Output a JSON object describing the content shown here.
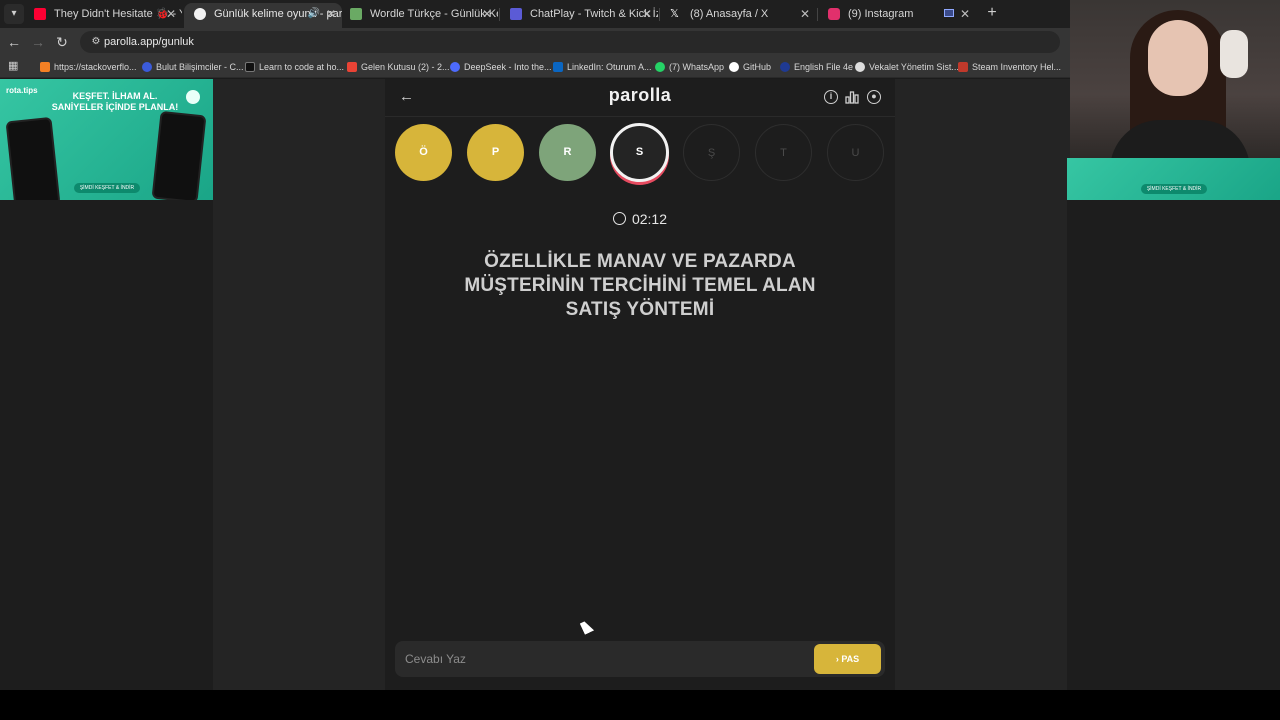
{
  "browser": {
    "tabs": [
      {
        "label": "They Didn't Hesitate 🐞 - YouTube",
        "favicon_color": "#ff0033",
        "icon": "youtube-icon"
      },
      {
        "label": "Günlük kelime oyunu - parolla",
        "favicon_color": "#f2f2f2",
        "icon": "parolla-icon",
        "active": true
      },
      {
        "label": "Wordle Türkçe - Günlük Kelime",
        "favicon_color": "#6aaa64",
        "icon": "wordle-icon"
      },
      {
        "label": "ChatPlay - Twitch & Kick İzleyici",
        "favicon_color": "#5b5bd6",
        "icon": "chatplay-icon"
      },
      {
        "label": "(8) Anasayfa / X",
        "favicon_color": "#ffffff",
        "icon": "x-icon"
      },
      {
        "label": "(9) Instagram",
        "favicon_color": "#e1306c",
        "icon": "instagram-icon"
      }
    ],
    "address": "parolla.app/gunluk",
    "bookmarks": [
      {
        "label": "https://stackoverflo...",
        "color": "#f48024"
      },
      {
        "label": "Bulut Bilişimciler - C...",
        "color": "#3b5bdb"
      },
      {
        "label": "Learn to code at ho...",
        "color": "#111111"
      },
      {
        "label": "Gelen Kutusu (2) - 2...",
        "color": "#ea4335"
      },
      {
        "label": "DeepSeek - Into the...",
        "color": "#4d6bfe"
      },
      {
        "label": "LinkedIn: Oturum A...",
        "color": "#0a66c2"
      },
      {
        "label": "(7) WhatsApp",
        "color": "#25d366"
      },
      {
        "label": "GitHub",
        "color": "#ffffff"
      },
      {
        "label": "English File 4e",
        "color": "#1f3a93"
      },
      {
        "label": "Vekalet Yönetim Sist...",
        "color": "#dddddd"
      },
      {
        "label": "Steam Inventory Hel...",
        "color": "#c0392b"
      }
    ]
  },
  "ad": {
    "logo": "rota.tips",
    "headline_line1": "KEŞFET. İLHAM AL.",
    "headline_line2": "SANİYELER İÇİNDE PLANLA!",
    "cta": "ŞİMDİ KEŞFET & İNDİR"
  },
  "app": {
    "brand": "parolla",
    "letters": [
      {
        "char": "Ö",
        "state": "yellow"
      },
      {
        "char": "P",
        "state": "yellow"
      },
      {
        "char": "R",
        "state": "green"
      },
      {
        "char": "S",
        "state": "current"
      },
      {
        "char": "Ş",
        "state": "pending"
      },
      {
        "char": "T",
        "state": "pending"
      },
      {
        "char": "U",
        "state": "pending"
      }
    ],
    "timer": "02:12",
    "question": "ÖZELLİKLE MANAV VE PAZARDA MÜŞTERİNİN TERCİHİNİ TEMEL ALAN SATIŞ YÖNTEMİ",
    "answer_placeholder": "Cevabı Yaz",
    "pass_label": "PAS"
  },
  "colors": {
    "yellow": "#d7b53a",
    "green": "#7ea47a",
    "accent_red": "#e64b60",
    "background": "#1d1d1d"
  }
}
